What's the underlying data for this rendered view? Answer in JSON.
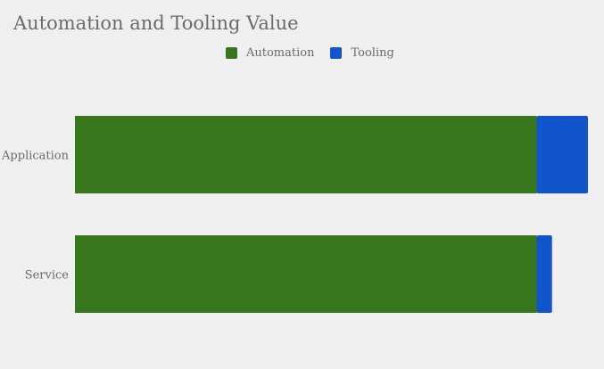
{
  "chart_data": {
    "type": "bar",
    "orientation": "horizontal",
    "stacked": true,
    "title": "Automation and Tooling Value",
    "categories": [
      "Application",
      "Service"
    ],
    "series": [
      {
        "name": "Automation",
        "color": "#38761d",
        "values": [
          90,
          90
        ]
      },
      {
        "name": "Tooling",
        "color": "#1155cc",
        "values": [
          10,
          3
        ]
      }
    ],
    "xlim": [
      0,
      100
    ],
    "grid": false,
    "legend_position": "top"
  }
}
